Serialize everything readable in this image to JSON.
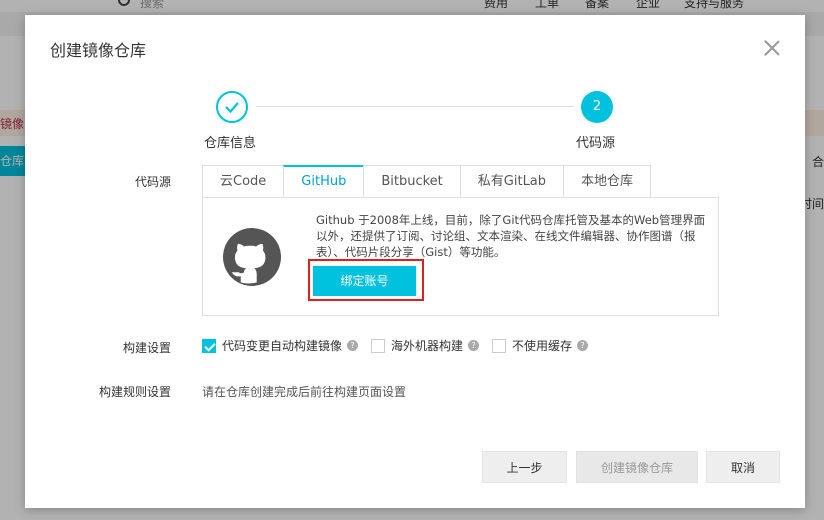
{
  "background": {
    "search_placeholder": "搜索",
    "nav_items": [
      "费用",
      "工单",
      "备案",
      "企业",
      "支持与服务"
    ],
    "warning_text": "镜像",
    "active_tab": "仓库",
    "right_texts": [
      "合",
      "时间"
    ]
  },
  "dialog": {
    "title": "创建镜像仓库",
    "steps": [
      {
        "label": "仓库信息",
        "number": "1",
        "status": "done"
      },
      {
        "label": "代码源",
        "number": "2",
        "status": "active"
      }
    ],
    "code_source_label": "代码源",
    "tabs": [
      {
        "label": "云Code",
        "active": false
      },
      {
        "label": "GitHub",
        "active": true
      },
      {
        "label": "Bitbucket",
        "active": false
      },
      {
        "label": "私有GitLab",
        "active": false
      },
      {
        "label": "本地仓库",
        "active": false
      }
    ],
    "github_description": "Github 于2008年上线，目前，除了Git代码仓库托管及基本的Web管理界面以外，还提供了订阅、讨论组、文本渲染、在线文件编辑器、协作图谱（报表）、代码片段分享（Gist）等功能。",
    "bind_button": "绑定账号",
    "build_settings_label": "构建设置",
    "build_options": [
      {
        "label": "代码变更自动构建镜像",
        "checked": true
      },
      {
        "label": "海外机器构建",
        "checked": false
      },
      {
        "label": "不使用缓存",
        "checked": false
      }
    ],
    "build_rules_label": "构建规则设置",
    "build_rules_text": "请在仓库创建完成后前往构建页面设置",
    "buttons": {
      "prev": "上一步",
      "create": "创建镜像仓库",
      "cancel": "取消"
    }
  },
  "colors": {
    "accent": "#00c1de",
    "highlight_border": "#e02020"
  }
}
